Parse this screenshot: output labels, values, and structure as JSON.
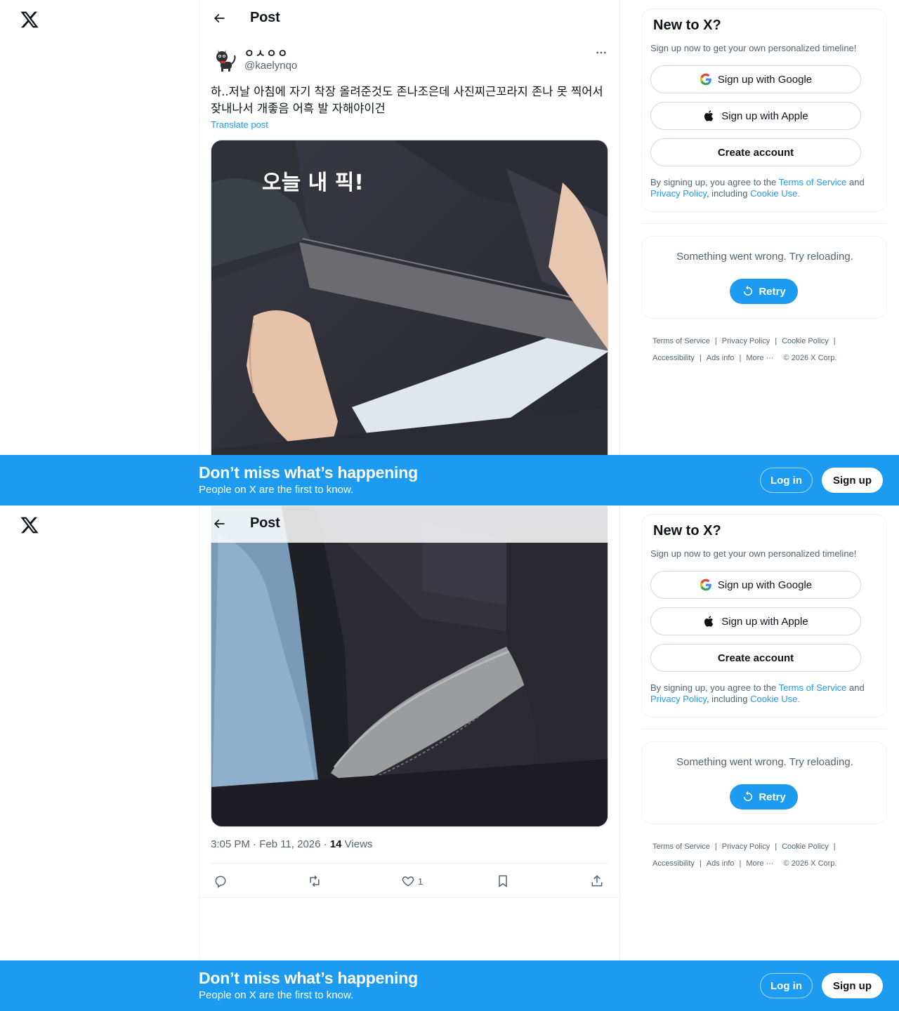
{
  "colors": {
    "accent": "#1d9bf0",
    "text": "#0f1419",
    "muted": "#536471",
    "border": "#eff3f4"
  },
  "header": {
    "title": "Post"
  },
  "post": {
    "author_name": "ㅇㅅㅇㅇ",
    "author_handle": "@kaelynqo",
    "text": "하..저날 아침에 자기 착장 올려준것도 존나조은데 사진찌근꼬라지 존나 못 찍어서 잦내나서 개좋음 어흑 발 자해야이건",
    "translate_label": "Translate post",
    "image_caption": "오늘 내 픽!",
    "time": "3:05 PM · Feb 11, 2026 · ",
    "views_count": "14",
    "views_label": " Views",
    "likes_count": "1"
  },
  "sidebar": {
    "signup": {
      "title": "New to X?",
      "subtitle": "Sign up now to get your own personalized timeline!",
      "google_label": "Sign up with Google",
      "apple_label": "Sign up with Apple",
      "create_label": "Create account",
      "legal_prefix": "By signing up, you agree to the ",
      "terms_link": "Terms of Service",
      "legal_and": " and ",
      "privacy_link": "Privacy Policy",
      "legal_including": ", including ",
      "cookie_link": "Cookie Use",
      "legal_end": "."
    },
    "error": {
      "text": "Something went wrong. Try reloading.",
      "retry_label": "Retry"
    },
    "footer": {
      "terms": "Terms of Service",
      "privacy": "Privacy Policy",
      "cookie": "Cookie Policy",
      "accessibility": "Accessibility",
      "ads": "Ads info",
      "more": "More ···",
      "copyright": "© 2026 X Corp."
    }
  },
  "banner": {
    "title": "Don’t miss what’s happening",
    "subtitle": "People on X are the first to know.",
    "login_label": "Log in",
    "signup_label": "Sign up"
  }
}
